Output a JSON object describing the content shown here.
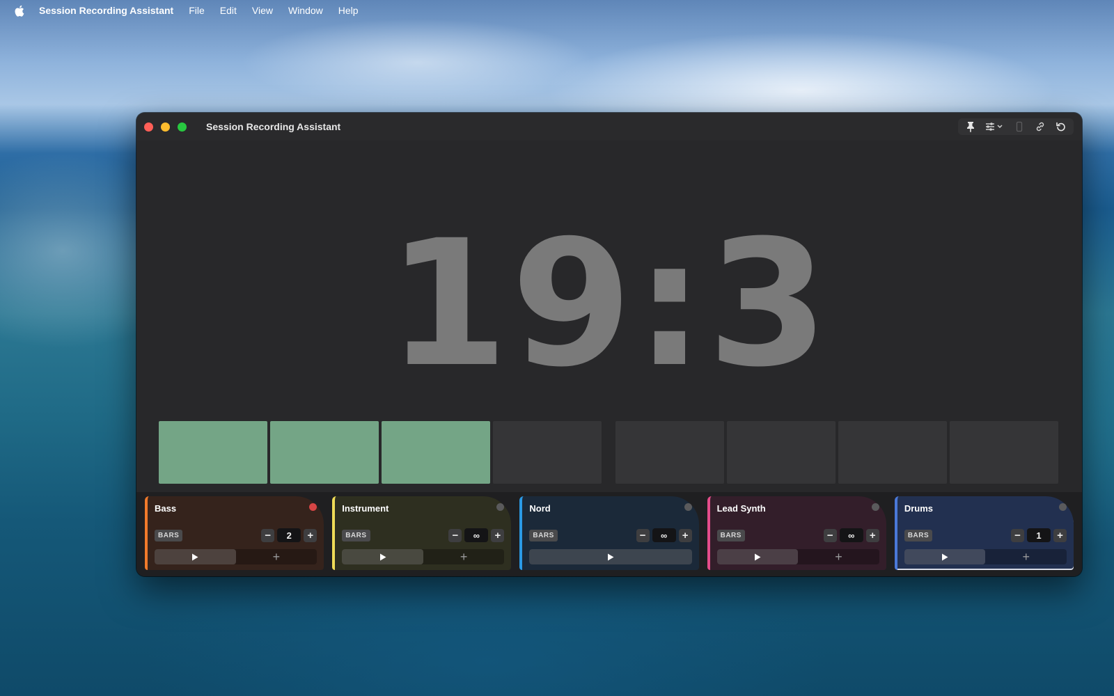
{
  "menubar": {
    "app_name": "Session Recording Assistant",
    "menus": [
      "File",
      "Edit",
      "View",
      "Window",
      "Help"
    ],
    "icon": "apple-icon"
  },
  "window": {
    "title": "Session Recording Assistant",
    "toolbar_icons": [
      "pin-icon",
      "sliders-icon",
      "battery-icon",
      "link-icon",
      "reset-icon"
    ]
  },
  "counter": {
    "display": "19:3"
  },
  "bar_blocks": {
    "total": 8,
    "filled": 3
  },
  "tracks": [
    {
      "name": "Bass",
      "bars_label": "BARS",
      "bars_value": "2",
      "armed": true,
      "color": "#f07a2b"
    },
    {
      "name": "Instrument",
      "bars_label": "BARS",
      "bars_value": "∞",
      "armed": false,
      "color": "#efdc57"
    },
    {
      "name": "Nord",
      "bars_label": "BARS",
      "bars_value": "∞",
      "armed": false,
      "color": "#2b9ae6"
    },
    {
      "name": "Lead Synth",
      "bars_label": "BARS",
      "bars_value": "∞",
      "armed": false,
      "color": "#e44d8a"
    },
    {
      "name": "Drums",
      "bars_label": "BARS",
      "bars_value": "1",
      "armed": false,
      "color": "#4a78d8"
    }
  ],
  "colors": {
    "block_filled": "#74a586",
    "block_empty": "#353537",
    "counter_text": "#7a7a7a",
    "record_armed": "#d64545"
  }
}
